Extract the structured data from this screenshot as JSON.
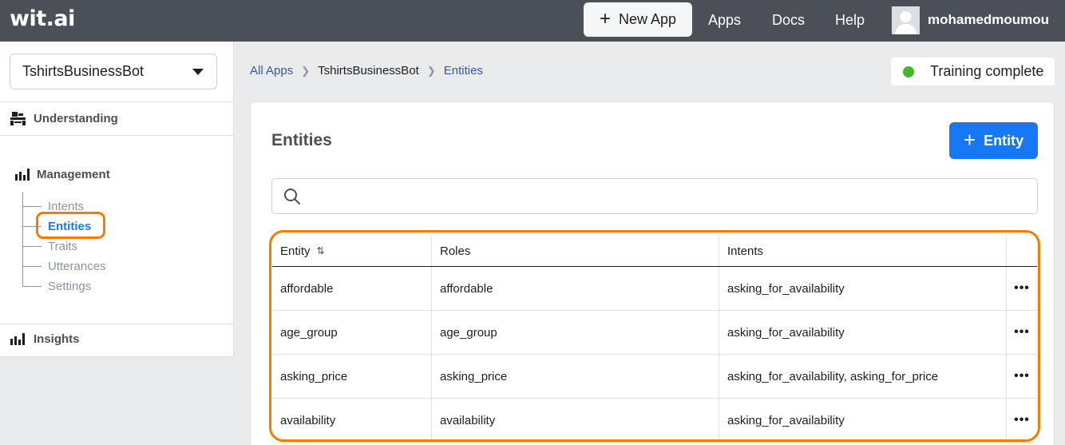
{
  "topbar": {
    "logo": "wit.ai",
    "new_app_label": "New App",
    "nav": [
      "Apps",
      "Docs",
      "Help"
    ],
    "username": "mohamedmoumou"
  },
  "sidebar": {
    "app_name": "TshirtsBusinessBot",
    "sections": {
      "understanding": "Understanding",
      "management": "Management",
      "insights": "Insights"
    },
    "management_items": [
      "Intents",
      "Entities",
      "Traits",
      "Utterances",
      "Settings"
    ],
    "active_item": "Entities"
  },
  "breadcrumb": {
    "all_apps": "All Apps",
    "app": "TshirtsBusinessBot",
    "current": "Entities"
  },
  "status": {
    "text": "Training complete",
    "color": "#42b72a"
  },
  "main": {
    "title": "Entities",
    "add_button_label": "Entity",
    "search_placeholder": "",
    "table": {
      "columns": [
        "Entity",
        "Roles",
        "Intents"
      ],
      "rows": [
        {
          "entity": "affordable",
          "roles": "affordable",
          "intents": "asking_for_availability"
        },
        {
          "entity": "age_group",
          "roles": "age_group",
          "intents": "asking_for_availability"
        },
        {
          "entity": "asking_price",
          "roles": "asking_price",
          "intents": "asking_for_availability, asking_for_price"
        },
        {
          "entity": "availability",
          "roles": "availability",
          "intents": "asking_for_availability"
        }
      ]
    }
  },
  "colors": {
    "primary": "#1877f2",
    "highlight": "#f57c00",
    "topbar": "#4b4f56"
  }
}
